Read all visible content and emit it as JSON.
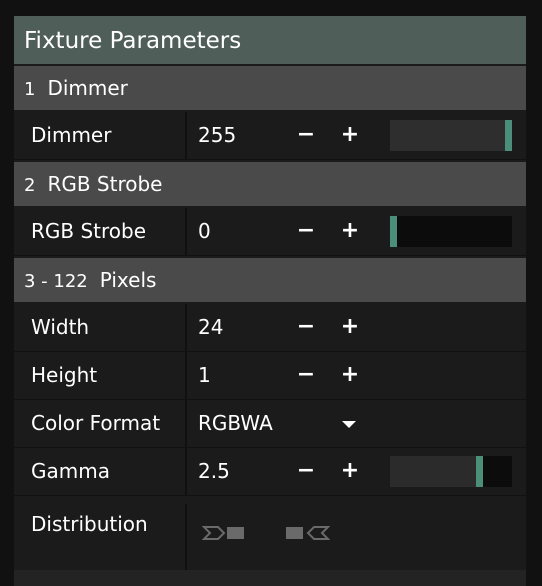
{
  "title": "Fixture Parameters",
  "sections": [
    {
      "num": "1",
      "label": "Dimmer"
    },
    {
      "num": "2",
      "label": "RGB Strobe"
    },
    {
      "num": "3 - 122",
      "label": "Pixels"
    }
  ],
  "rows": {
    "dimmer": {
      "label": "Dimmer",
      "value": "255",
      "level": 1.0
    },
    "rgb_strobe": {
      "label": "RGB Strobe",
      "value": "0",
      "level": 0.0
    },
    "width": {
      "label": "Width",
      "value": "24"
    },
    "height": {
      "label": "Height",
      "value": "1"
    },
    "color_format": {
      "label": "Color Format",
      "value": "RGBWA"
    },
    "gamma": {
      "label": "Gamma",
      "value": "2.5",
      "level": 0.75
    },
    "distribution": {
      "label": "Distribution",
      "icons": [
        "distribution-forward-icon",
        "distribution-reverse-icon"
      ]
    }
  },
  "controls": {
    "minus": "−",
    "plus": "+"
  },
  "colors": {
    "title_bg": "#4f5e59",
    "section_bg": "#4a4a4a",
    "accent": "#4b8f7a"
  }
}
